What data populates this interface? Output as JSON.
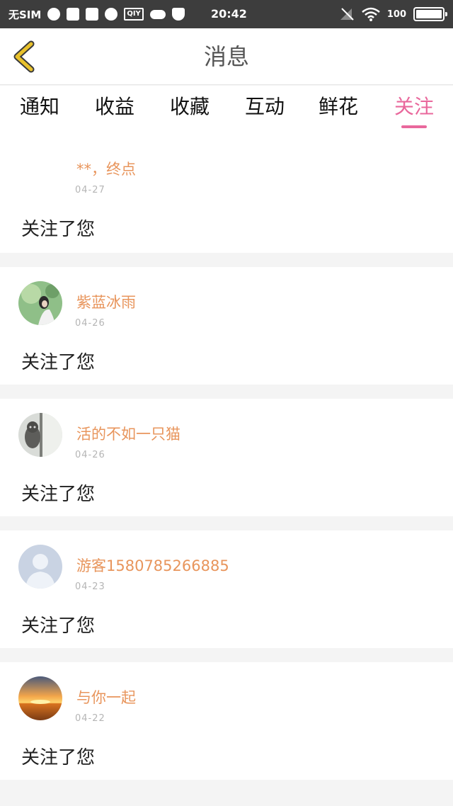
{
  "status_bar": {
    "carrier": "无SIM",
    "left_icons": [
      "music-note-icon",
      "clipboard-check-icon",
      "mail-icon",
      "globe-icon",
      "iqiyi-icon",
      "cloud-icon",
      "shield-icon"
    ],
    "iqiyi_text": "QIY",
    "time": "20:42",
    "battery_text": "100",
    "battery_level": 1.0
  },
  "header": {
    "title": "消息",
    "back_icon": "chevron-left-icon",
    "accent_color": "#e9689c",
    "back_color": "#e8c12b"
  },
  "tabs": [
    {
      "label": "通知",
      "active": false
    },
    {
      "label": "收益",
      "active": false
    },
    {
      "label": "收藏",
      "active": false
    },
    {
      "label": "互动",
      "active": false
    },
    {
      "label": "鲜花",
      "active": false
    },
    {
      "label": "关注",
      "active": true
    }
  ],
  "messages": [
    {
      "name": "**，终点",
      "date": "04-27",
      "text": "关注了您",
      "avatar": "none"
    },
    {
      "name": "紫蓝冰雨",
      "date": "04-26",
      "text": "关注了您",
      "avatar": "girl-in-green-photo"
    },
    {
      "name": "活的不如一只猫",
      "date": "04-26",
      "text": "关注了您",
      "avatar": "window-cat-photo"
    },
    {
      "name": "游客1580785266885",
      "date": "04-23",
      "text": "关注了您",
      "avatar": "default-person-icon"
    },
    {
      "name": "与你一起",
      "date": "04-22",
      "text": "关注了您",
      "avatar": "sunset-photo"
    }
  ]
}
